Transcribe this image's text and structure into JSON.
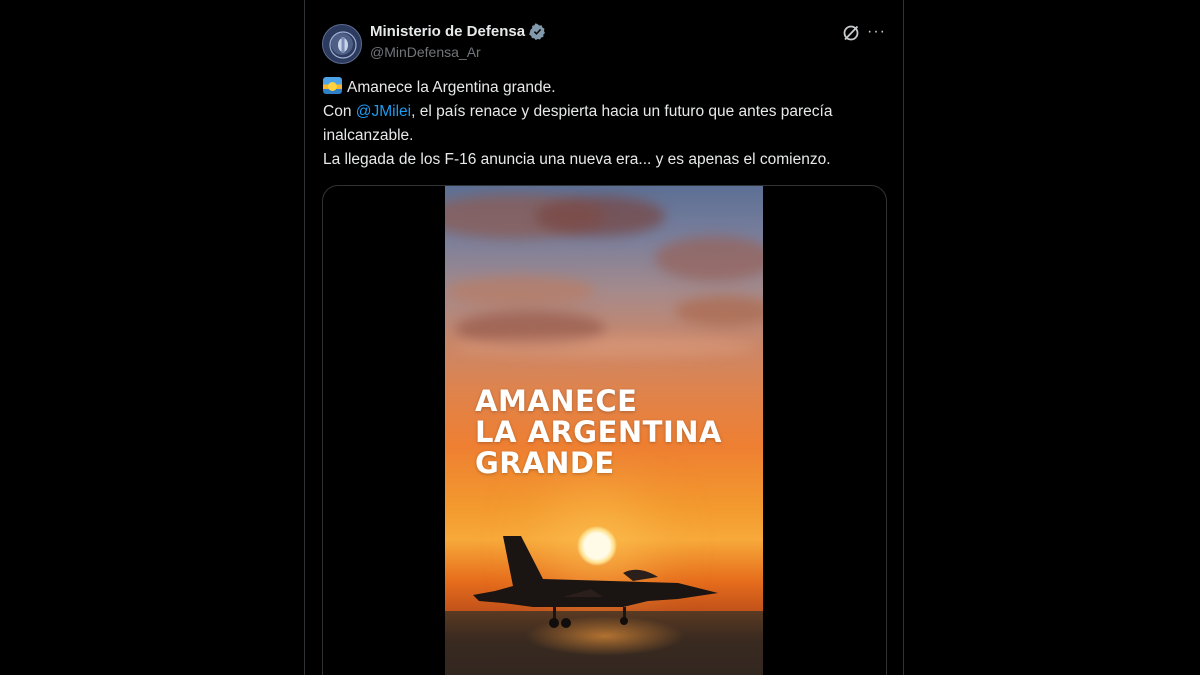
{
  "post": {
    "author": {
      "display_name": "Ministerio de Defensa",
      "handle": "@MinDefensa_Ar",
      "verified": true,
      "avatar_icon": "ministry-seal-icon"
    },
    "actions": {
      "grok_icon": "grok-icon",
      "more_label": "···"
    },
    "text": {
      "line1": "Amanece la Argentina grande.",
      "line2_prefix": "Con ",
      "mention": "@JMilei",
      "line2_suffix": ", el país renace y despierta hacia un futuro que antes parecía",
      "line3": "inalcanzable.",
      "line4": "La llegada de los F-16 anuncia una nueva era... y es apenas el comienzo.",
      "emoji": "sunrise-emoji"
    },
    "media": {
      "headline": [
        "AMANECE",
        "LA ARGENTINA",
        "GRANDE"
      ]
    }
  },
  "colors": {
    "background": "#000000",
    "text": "#e7e9ea",
    "secondary": "#71767b",
    "link": "#1d9bf0",
    "verified": "#829aab",
    "border": "#2f3336"
  }
}
